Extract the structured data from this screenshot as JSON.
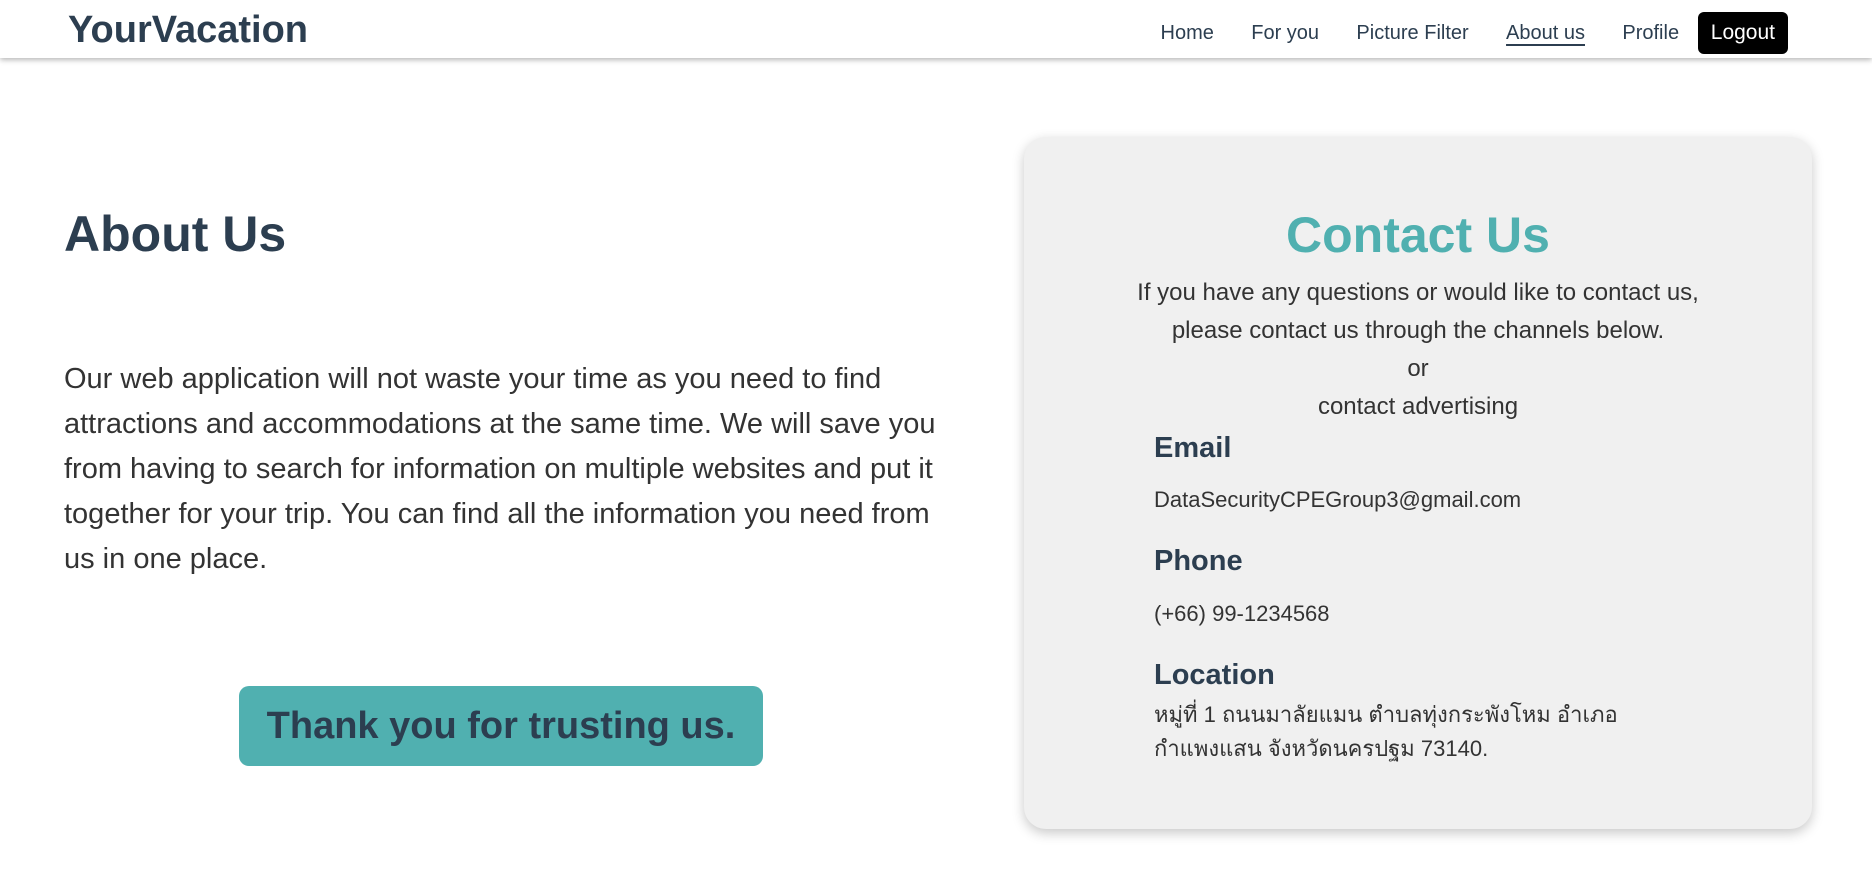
{
  "header": {
    "brand": "YourVacation",
    "nav": [
      {
        "label": "Home"
      },
      {
        "label": "For you"
      },
      {
        "label": "Picture Filter"
      },
      {
        "label": "About us",
        "active": true
      },
      {
        "label": "Profile"
      }
    ],
    "logout_label": "Logout"
  },
  "about": {
    "title": "About Us",
    "text": "Our web application will not waste your time as you need to find attractions and accommodations at the same time. We will save you from having to search for information on multiple websites and put it together for your trip. You can find all the information you need from us in one place.",
    "thanks_button": "Thank you for trusting us."
  },
  "contact": {
    "title": "Contact Us",
    "intro_line1": "If you have any questions or would like to contact us,",
    "intro_line2": "please contact us through the channels below.",
    "intro_or": "or",
    "intro_line3": "contact advertising",
    "email_label": "Email",
    "email_value": "DataSecurityCPEGroup3@gmail.com",
    "phone_label": "Phone",
    "phone_value": "(+66) 99-1234568",
    "location_label": "Location",
    "location_line1": "หมู่ที่ 1 ถนนมาลัยแมน ตำบลทุ่งกระพังโหม อำเภอ",
    "location_line2": "กำแพงแสน จังหวัดนครปฐม 73140."
  },
  "colors": {
    "primary_text": "#2c3e50",
    "accent": "#50b0b0",
    "card_bg": "#f0f0f0",
    "logout_bg": "#000000"
  }
}
